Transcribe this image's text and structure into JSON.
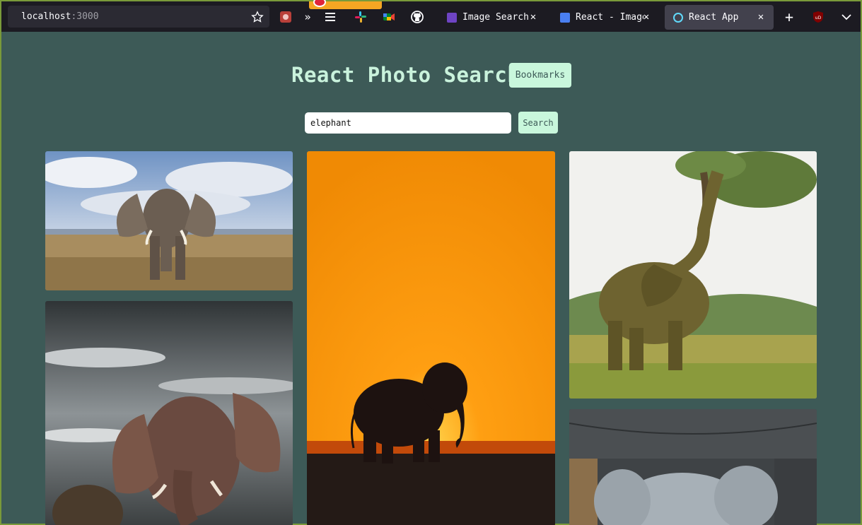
{
  "browser": {
    "url_host": "localhost",
    "url_port": ":3000",
    "tabs": [
      {
        "label": "Image Search A",
        "favicon_color": "#6e44c4"
      },
      {
        "label": "React - Image",
        "favicon_color": "#4a7ff0"
      },
      {
        "label": "React App",
        "favicon_color": "#61dafb"
      }
    ]
  },
  "app": {
    "title": "React Photo Search",
    "bookmarks_label": "Bookmarks",
    "search_value": "elephant",
    "search_button_label": "Search"
  },
  "photos": [
    {
      "subject": "elephant-savanna-clouds"
    },
    {
      "subject": "elephant-silhouette-sunset"
    },
    {
      "subject": "elephant-eating-tree"
    },
    {
      "subject": "elephant-monochrome-sky"
    },
    {
      "subject": "baby-elephant-closeup"
    }
  ]
}
